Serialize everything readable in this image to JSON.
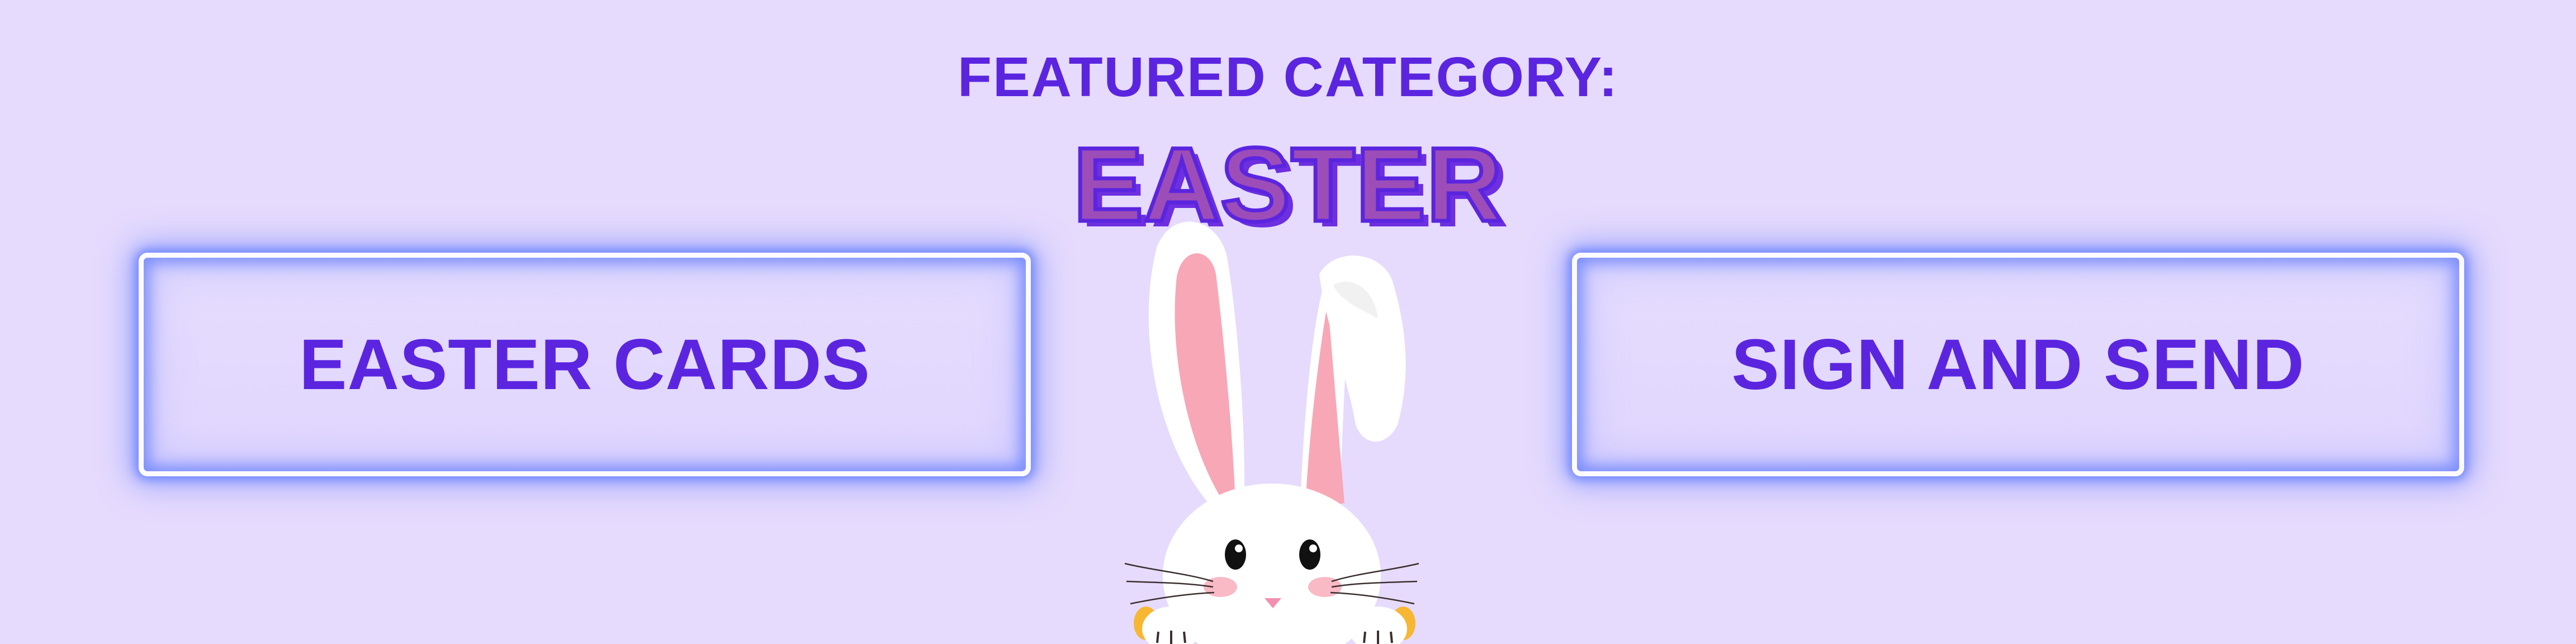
{
  "banner": {
    "featured_label": "FEATURED CATEGORY:",
    "category_title": "EASTER"
  },
  "buttons": {
    "left_label": "EASTER CARDS",
    "right_label": "SIGN AND SEND"
  },
  "colors": {
    "background": "#e6dbfd",
    "text_accent": "#5b25e0",
    "title_fill": "#9d4db7",
    "neon_glow": "#6c84ff"
  },
  "icons": {
    "mascot": "easter-bunny-icon"
  }
}
